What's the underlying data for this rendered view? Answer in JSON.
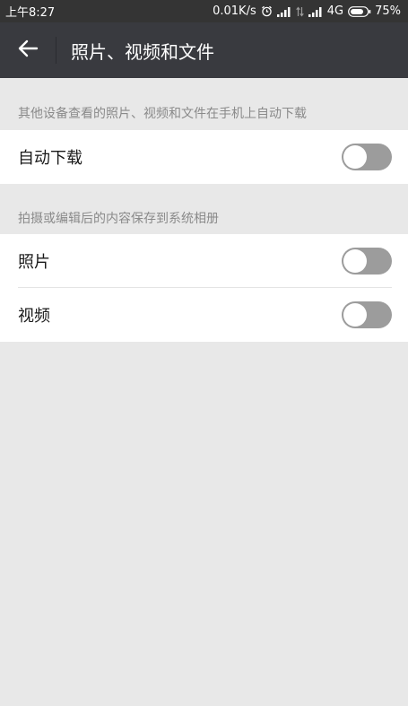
{
  "status_bar": {
    "time": "上午8:27",
    "network_speed": "0.01K/s",
    "network_type": "4G",
    "battery": "75%",
    "icons": [
      "alarm-icon",
      "signal-icon",
      "data-arrows-icon",
      "signal-icon",
      "battery-icon"
    ]
  },
  "header": {
    "back_icon": "arrow-left-icon",
    "title": "照片、视频和文件"
  },
  "sections": {
    "auto_download": {
      "header": "其他设备查看的照片、视频和文件在手机上自动下载",
      "label": "自动下载",
      "enabled": false
    },
    "save_to_album": {
      "header": "拍摄或编辑后的内容保存到系统相册",
      "items": [
        {
          "label": "照片",
          "enabled": false
        },
        {
          "label": "视频",
          "enabled": false
        }
      ]
    }
  },
  "colors": {
    "status_bar": "#343434",
    "title_bar": "#393a3f",
    "background": "#e8e8e8",
    "toggle_off": "#9c9c9c"
  }
}
